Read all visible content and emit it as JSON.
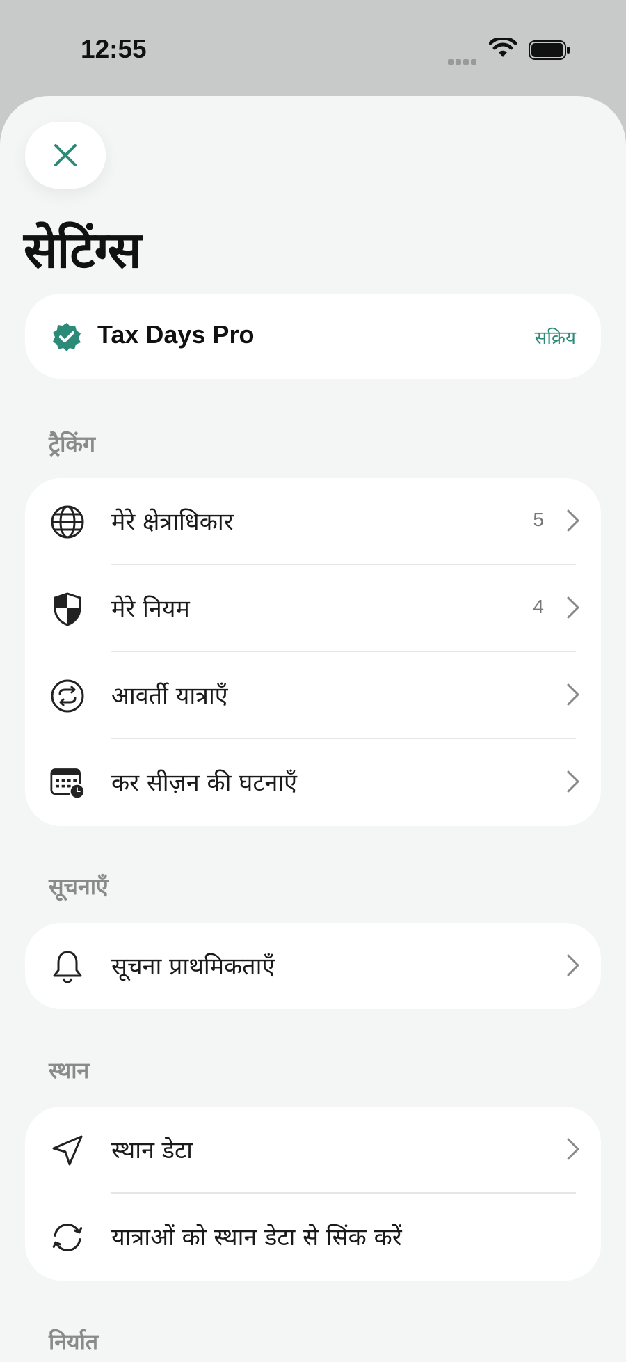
{
  "status_bar": {
    "time": "12:55"
  },
  "sheet": {
    "title": "सेटिंग्स",
    "pro": {
      "name": "Tax Days Pro",
      "status": "सक्रिय"
    },
    "sections": {
      "tracking": {
        "label": "ट्रैकिंग",
        "items": [
          {
            "label": "मेरे क्षेत्राधिकार",
            "count": "5",
            "icon": "globe-icon"
          },
          {
            "label": "मेरे नियम",
            "count": "4",
            "icon": "shield-icon"
          },
          {
            "label": "आवर्ती यात्राएँ",
            "icon": "repeat-icon"
          },
          {
            "label": "कर सीज़न की घटनाएँ",
            "icon": "calendar-clock-icon"
          }
        ]
      },
      "notifications": {
        "label": "सूचनाएँ",
        "items": [
          {
            "label": "सूचना प्राथमिकताएँ",
            "icon": "bell-icon"
          }
        ]
      },
      "location": {
        "label": "स्थान",
        "items": [
          {
            "label": "स्थान डेटा",
            "icon": "location-arrow-icon"
          },
          {
            "label": "यात्राओं को स्थान डेटा से सिंक करें",
            "icon": "sync-icon"
          }
        ]
      },
      "export": {
        "label": "निर्यात"
      }
    }
  },
  "colors": {
    "accent": "#2e8a78",
    "background": "#f4f6f5",
    "card": "#ffffff"
  }
}
